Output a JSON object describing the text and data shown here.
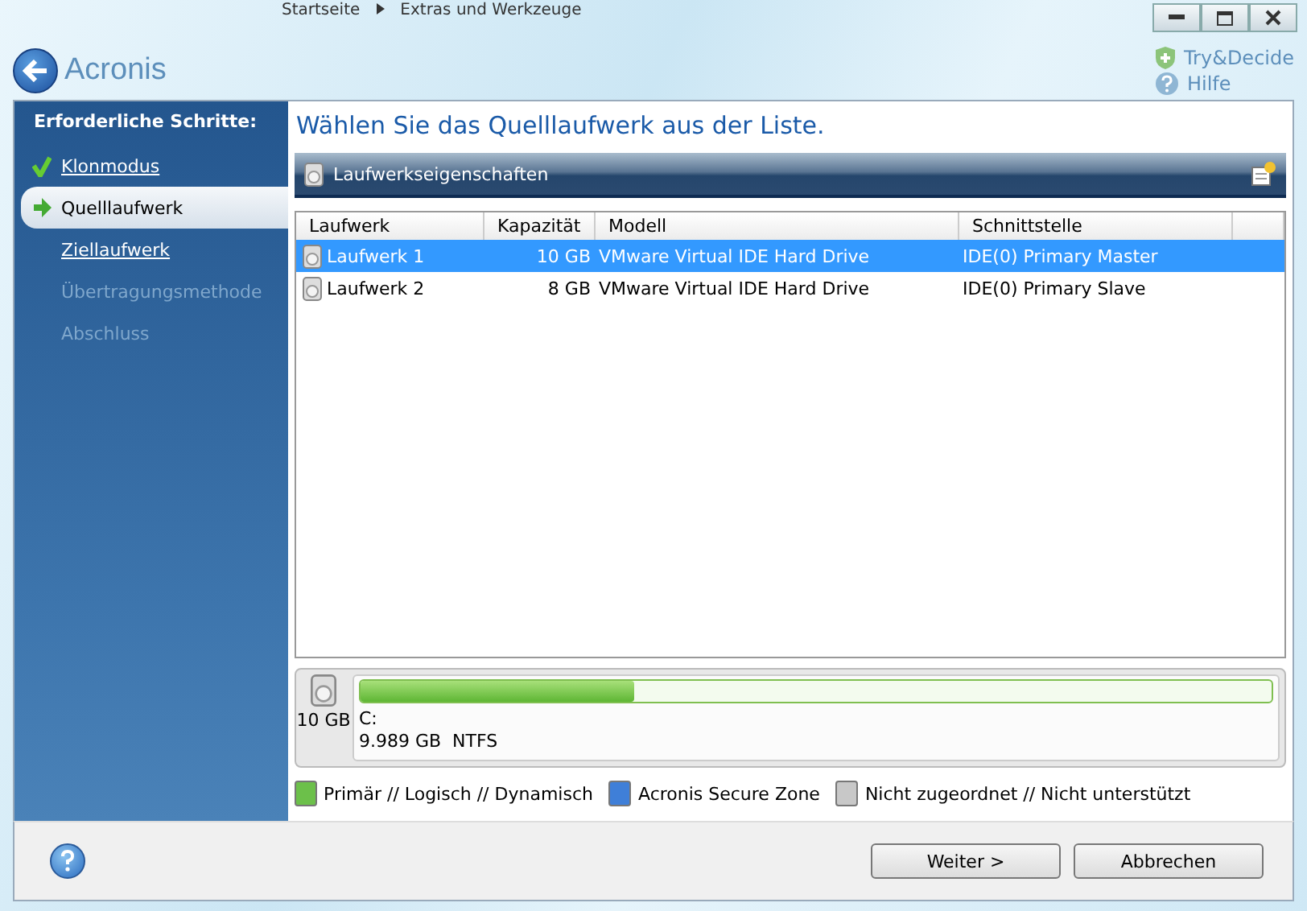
{
  "breadcrumb": [
    "Startseite",
    "Extras und Werkzeuge"
  ],
  "header": {
    "logo": "Acronis",
    "links": [
      "Try&Decide",
      "Hilfe"
    ]
  },
  "sidebar": {
    "title": "Erforderliche Schritte:",
    "steps": [
      {
        "label": "Klonmodus",
        "completed": true,
        "selected": false,
        "disabled": false
      },
      {
        "label": "Quelllaufwerk",
        "completed": false,
        "selected": true,
        "disabled": false
      },
      {
        "label": "Ziellaufwerk",
        "completed": false,
        "selected": false,
        "disabled": false
      },
      {
        "label": "Übertragungsmethode",
        "completed": false,
        "selected": false,
        "disabled": true
      },
      {
        "label": "Abschluss",
        "completed": false,
        "selected": false,
        "disabled": true
      }
    ]
  },
  "heading": "Wählen Sie das Quelllaufwerk aus der Liste.",
  "toolbar": {
    "title": "Laufwerkseigenschaften"
  },
  "table": {
    "columns": [
      "Laufwerk",
      "Kapazität",
      "Modell",
      "Schnittstelle"
    ],
    "rows": [
      {
        "cells": [
          "Laufwerk 1",
          "10 GB",
          "VMware Virtual IDE Hard Drive",
          "IDE(0) Primary Master"
        ],
        "selected": true
      },
      {
        "cells": [
          "Laufwerk 2",
          "8 GB",
          "VMware Virtual IDE Hard Drive",
          "IDE(0) Primary Slave"
        ],
        "selected": false
      }
    ]
  },
  "disk": {
    "size": "10 GB",
    "partition": "C:",
    "info": "9.989 GB  NTFS",
    "level": 0.3
  },
  "legend": [
    {
      "label": "Primär // Logisch // Dynamisch",
      "color": "#6cc04a"
    },
    {
      "label": "Acronis Secure Zone",
      "color": "#3f7fd8"
    },
    {
      "label": "Nicht zugeordnet // Nicht unterstützt",
      "color": "#c8c8c8"
    }
  ],
  "buttons": [
    "Weiter >",
    "Abbrechen"
  ]
}
